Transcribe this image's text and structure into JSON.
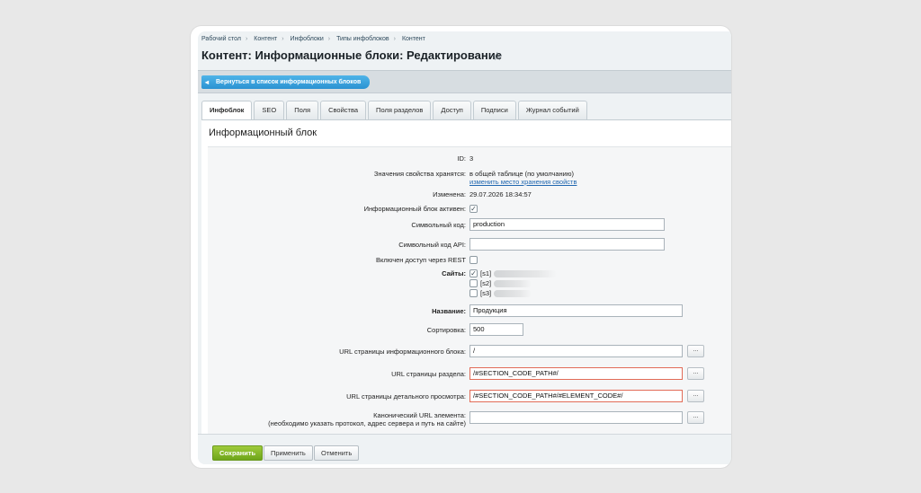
{
  "breadcrumb": [
    "Рабочий стол",
    "Контент",
    "Инфоблоки",
    "Типы инфоблоков",
    "Контент"
  ],
  "page_title": "Контент: Информационные блоки: Редактирование",
  "back_button": "Вернуться в список информационных блоков",
  "tabs": [
    "Инфоблок",
    "SEO",
    "Поля",
    "Свойства",
    "Поля разделов",
    "Доступ",
    "Подписи",
    "Журнал событий"
  ],
  "section_title": "Информационный блок",
  "fields": {
    "id": {
      "label": "ID:",
      "value": "3"
    },
    "storage": {
      "label": "Значения свойства хранятся:",
      "value": "в общей таблице (по умолчанию)",
      "link": "изменить место хранения свойств"
    },
    "modified": {
      "label": "Изменена:",
      "value": "29.07.2026 18:34:57"
    },
    "active": {
      "label": "Информационный блок активен:",
      "checked": true
    },
    "code": {
      "label": "Символьный код:",
      "value": "production"
    },
    "api_code": {
      "label": "Символьный код API:",
      "value": ""
    },
    "rest": {
      "label": "Включен доступ через REST",
      "checked": false
    },
    "sites": {
      "label": "Сайты:",
      "items": [
        {
          "code": "[s1]",
          "checked": true
        },
        {
          "code": "[s2]",
          "checked": false
        },
        {
          "code": "[s3]",
          "checked": false
        }
      ]
    },
    "name": {
      "label": "Название:",
      "value": "Продукция"
    },
    "sort": {
      "label": "Сортировка:",
      "value": "500"
    },
    "list_url": {
      "label": "URL страницы информационного блока:",
      "value": "/"
    },
    "section_url": {
      "label": "URL страницы раздела:",
      "value": "/#SECTION_CODE_PATH#/"
    },
    "detail_url": {
      "label": "URL страницы детального просмотра:",
      "value": "/#SECTION_CODE_PATH#/#ELEMENT_CODE#/"
    },
    "canonical_url": {
      "label": "Канонический URL элемента:",
      "label2": "(необходимо указать протокол, адрес сервера и путь на сайте)",
      "value": ""
    }
  },
  "dots_label": "...",
  "checkmark": "✓",
  "footer": {
    "save": "Сохранить",
    "apply": "Применить",
    "cancel": "Отменить"
  },
  "colors": {
    "accent": "#2a92d2",
    "save": "#6ea51a",
    "error_border": "#e26b57",
    "link": "#2067b0"
  }
}
